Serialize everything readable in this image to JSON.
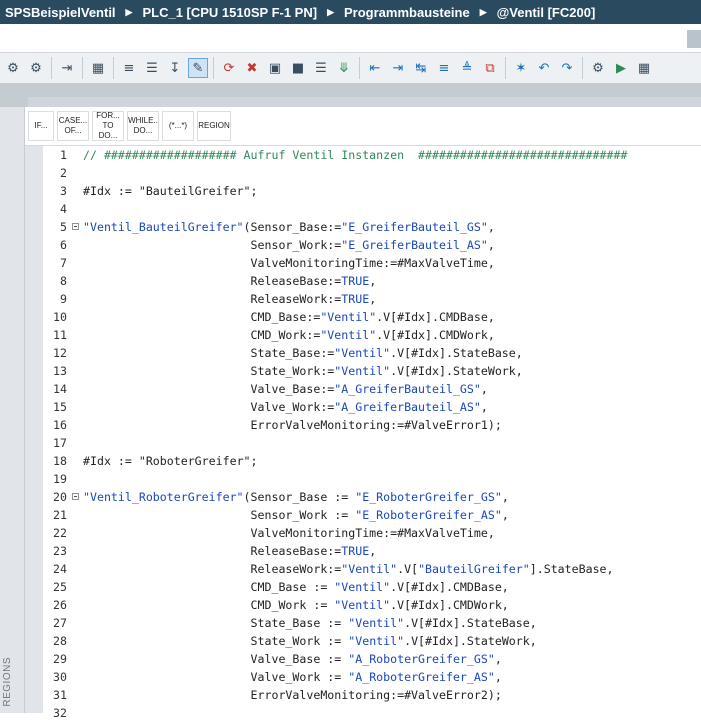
{
  "breadcrumb": [
    "SPSBeispielVentil",
    "PLC_1 [CPU 1510SP F-1 PN]",
    "Programmbausteine",
    "@Ventil [FC200]"
  ],
  "toolbar_icons": [
    "network-up-icon",
    "network-down-icon",
    "insert-network-icon",
    "monitor-icon",
    "block-interface-icon",
    "list-icon",
    "download-icon",
    "pin-icon",
    "go-to-error-icon",
    "delete-error-icon",
    "compare-icon",
    "replace-icon",
    "list-icon-2",
    "arrow-down-icon",
    "indent-left-icon",
    "indent-right-icon",
    "outdent-icon",
    "comment-icon",
    "uncomment-icon",
    "bookmark-icon",
    "bookmark-next-icon",
    "bookmark-prev-icon",
    "watch-icon",
    "step-icon",
    "breakpoint-icon"
  ],
  "instructions": [
    {
      "line1": "IF...",
      "line2": ""
    },
    {
      "line1": "CASE...",
      "line2": "OF..."
    },
    {
      "line1": "FOR...",
      "line2": "TO DO..."
    },
    {
      "line1": "WHILE..",
      "line2": "DO..."
    },
    {
      "line1": "(*...*)",
      "line2": ""
    },
    {
      "line1": "REGION",
      "line2": ""
    }
  ],
  "sidebar_label": "REGIONS",
  "code_lines": [
    {
      "n": "1",
      "segs": [
        {
          "c": "cmt",
          "t": "// ################### Aufruf Ventil Instanzen  ##############################"
        }
      ]
    },
    {
      "n": "2",
      "segs": []
    },
    {
      "n": "3",
      "segs": [
        {
          "c": "def",
          "t": "#Idx := "
        },
        {
          "c": "def",
          "t": "\"BauteilGreifer\""
        },
        {
          "c": "def",
          "t": ";"
        }
      ]
    },
    {
      "n": "4",
      "segs": []
    },
    {
      "n": "5",
      "fold": true,
      "segs": [
        {
          "c": "str",
          "t": "\"Ventil_BauteilGreifer\""
        },
        {
          "c": "def",
          "t": "(Sensor_Base:="
        },
        {
          "c": "str",
          "t": "\"E_GreiferBauteil_GS\""
        },
        {
          "c": "def",
          "t": ","
        }
      ]
    },
    {
      "n": "6",
      "segs": [
        {
          "c": "def",
          "t": "                        Sensor_Work:="
        },
        {
          "c": "str",
          "t": "\"E_GreiferBauteil_AS\""
        },
        {
          "c": "def",
          "t": ","
        }
      ]
    },
    {
      "n": "7",
      "segs": [
        {
          "c": "def",
          "t": "                        ValveMonitoringTime:=#MaxValveTime,"
        }
      ]
    },
    {
      "n": "8",
      "segs": [
        {
          "c": "def",
          "t": "                        ReleaseBase:="
        },
        {
          "c": "kw",
          "t": "TRUE"
        },
        {
          "c": "def",
          "t": ","
        }
      ]
    },
    {
      "n": "9",
      "segs": [
        {
          "c": "def",
          "t": "                        ReleaseWork:="
        },
        {
          "c": "kw",
          "t": "TRUE"
        },
        {
          "c": "def",
          "t": ","
        }
      ]
    },
    {
      "n": "10",
      "segs": [
        {
          "c": "def",
          "t": "                        CMD_Base:="
        },
        {
          "c": "str",
          "t": "\"Ventil\""
        },
        {
          "c": "def",
          "t": ".V[#Idx].CMDBase,"
        }
      ]
    },
    {
      "n": "11",
      "segs": [
        {
          "c": "def",
          "t": "                        CMD_Work:="
        },
        {
          "c": "str",
          "t": "\"Ventil\""
        },
        {
          "c": "def",
          "t": ".V[#Idx].CMDWork,"
        }
      ]
    },
    {
      "n": "12",
      "segs": [
        {
          "c": "def",
          "t": "                        State_Base:="
        },
        {
          "c": "str",
          "t": "\"Ventil\""
        },
        {
          "c": "def",
          "t": ".V[#Idx].StateBase,"
        }
      ]
    },
    {
      "n": "13",
      "segs": [
        {
          "c": "def",
          "t": "                        State_Work:="
        },
        {
          "c": "str",
          "t": "\"Ventil\""
        },
        {
          "c": "def",
          "t": ".V[#Idx].StateWork,"
        }
      ]
    },
    {
      "n": "14",
      "segs": [
        {
          "c": "def",
          "t": "                        Valve_Base:="
        },
        {
          "c": "str",
          "t": "\"A_GreiferBauteil_GS\""
        },
        {
          "c": "def",
          "t": ","
        }
      ]
    },
    {
      "n": "15",
      "segs": [
        {
          "c": "def",
          "t": "                        Valve_Work:="
        },
        {
          "c": "str",
          "t": "\"A_GreiferBauteil_AS\""
        },
        {
          "c": "def",
          "t": ","
        }
      ]
    },
    {
      "n": "16",
      "segs": [
        {
          "c": "def",
          "t": "                        ErrorValveMonitoring:=#ValveError1);"
        }
      ]
    },
    {
      "n": "17",
      "segs": []
    },
    {
      "n": "18",
      "segs": [
        {
          "c": "def",
          "t": "#Idx := "
        },
        {
          "c": "def",
          "t": "\"RoboterGreifer\""
        },
        {
          "c": "def",
          "t": ";"
        }
      ]
    },
    {
      "n": "19",
      "segs": []
    },
    {
      "n": "20",
      "fold": true,
      "segs": [
        {
          "c": "str",
          "t": "\"Ventil_RoboterGreifer\""
        },
        {
          "c": "def",
          "t": "(Sensor_Base := "
        },
        {
          "c": "str",
          "t": "\"E_RoboterGreifer_GS\""
        },
        {
          "c": "def",
          "t": ","
        }
      ]
    },
    {
      "n": "21",
      "segs": [
        {
          "c": "def",
          "t": "                        Sensor_Work := "
        },
        {
          "c": "str",
          "t": "\"E_RoboterGreifer_AS\""
        },
        {
          "c": "def",
          "t": ","
        }
      ]
    },
    {
      "n": "22",
      "segs": [
        {
          "c": "def",
          "t": "                        ValveMonitoringTime:=#MaxValveTime,"
        }
      ]
    },
    {
      "n": "23",
      "segs": [
        {
          "c": "def",
          "t": "                        ReleaseBase:="
        },
        {
          "c": "kw",
          "t": "TRUE"
        },
        {
          "c": "def",
          "t": ","
        }
      ]
    },
    {
      "n": "24",
      "segs": [
        {
          "c": "def",
          "t": "                        ReleaseWork:="
        },
        {
          "c": "str",
          "t": "\"Ventil\""
        },
        {
          "c": "def",
          "t": ".V["
        },
        {
          "c": "str",
          "t": "\"BauteilGreifer\""
        },
        {
          "c": "def",
          "t": "].StateBase,"
        }
      ]
    },
    {
      "n": "25",
      "segs": [
        {
          "c": "def",
          "t": "                        CMD_Base := "
        },
        {
          "c": "str",
          "t": "\"Ventil\""
        },
        {
          "c": "def",
          "t": ".V[#Idx].CMDBase,"
        }
      ]
    },
    {
      "n": "26",
      "segs": [
        {
          "c": "def",
          "t": "                        CMD_Work := "
        },
        {
          "c": "str",
          "t": "\"Ventil\""
        },
        {
          "c": "def",
          "t": ".V[#Idx].CMDWork,"
        }
      ]
    },
    {
      "n": "27",
      "segs": [
        {
          "c": "def",
          "t": "                        State_Base := "
        },
        {
          "c": "str",
          "t": "\"Ventil\""
        },
        {
          "c": "def",
          "t": ".V[#Idx].StateBase,"
        }
      ]
    },
    {
      "n": "28",
      "segs": [
        {
          "c": "def",
          "t": "                        State_Work := "
        },
        {
          "c": "str",
          "t": "\"Ventil\""
        },
        {
          "c": "def",
          "t": ".V[#Idx].StateWork,"
        }
      ]
    },
    {
      "n": "29",
      "segs": [
        {
          "c": "def",
          "t": "                        Valve_Base := "
        },
        {
          "c": "str",
          "t": "\"A_RoboterGreifer_GS\""
        },
        {
          "c": "def",
          "t": ","
        }
      ]
    },
    {
      "n": "30",
      "segs": [
        {
          "c": "def",
          "t": "                        Valve_Work := "
        },
        {
          "c": "str",
          "t": "\"A_RoboterGreifer_AS\""
        },
        {
          "c": "def",
          "t": ","
        }
      ]
    },
    {
      "n": "31",
      "segs": [
        {
          "c": "def",
          "t": "                        ErrorValveMonitoring:=#ValveError2);"
        }
      ]
    },
    {
      "n": "32",
      "segs": []
    }
  ]
}
